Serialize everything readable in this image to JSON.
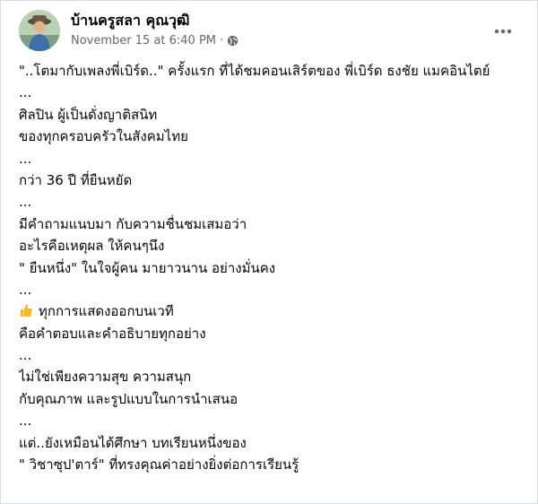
{
  "post": {
    "author": "บ้านครูสลา คุณวุฒิ",
    "date": "November 15 at 6:40 PM",
    "separator": "·",
    "audience_icon": "globe-icon",
    "more_icon": "more-options-icon",
    "lines": [
      "\"..โตมากับเพลงพี่เบิร์ด..\" ครั้งแรก ที่ได้ชมคอนเสิร์ตของ พี่เบิร์ด ธงชัย แมคอินไตย์",
      "...",
      "ศิลปิน ผู้เป็นดั่งญาติสนิท",
      "ของทุกครอบครัวในสังคมไทย",
      "...",
      "กว่า 36 ปี ที่ยืนหยัด",
      "...",
      "มีคำถามแนบมา กับความชื่นชมเสมอว่า",
      "อะไรคือเหตุผล ให้คนๆนึง",
      "\" ยืนหนึ่ง\" ในใจผู้คน มายาวนาน อย่างมั่นคง",
      "...",
      "ทุกการแสดงออกบนเวที",
      "คือคำตอบและคำอธิบายทุกอย่าง",
      "...",
      "ไม่ใช่เพียงความสุข ความสนุก",
      "กับคุณภาพ และรูปแบบในการนำเสนอ",
      "...",
      "แต่..ยังเหมือนได้ศึกษา บทเรียนหนึ่งของ",
      "\" วิชาซุป'ตาร์\" ที่ทรงคุณค่าอย่างยิ่งต่อการเรียนรู้"
    ],
    "emoji_icon": "thumbs-up-icon",
    "emoji_color": "#f7b928"
  }
}
